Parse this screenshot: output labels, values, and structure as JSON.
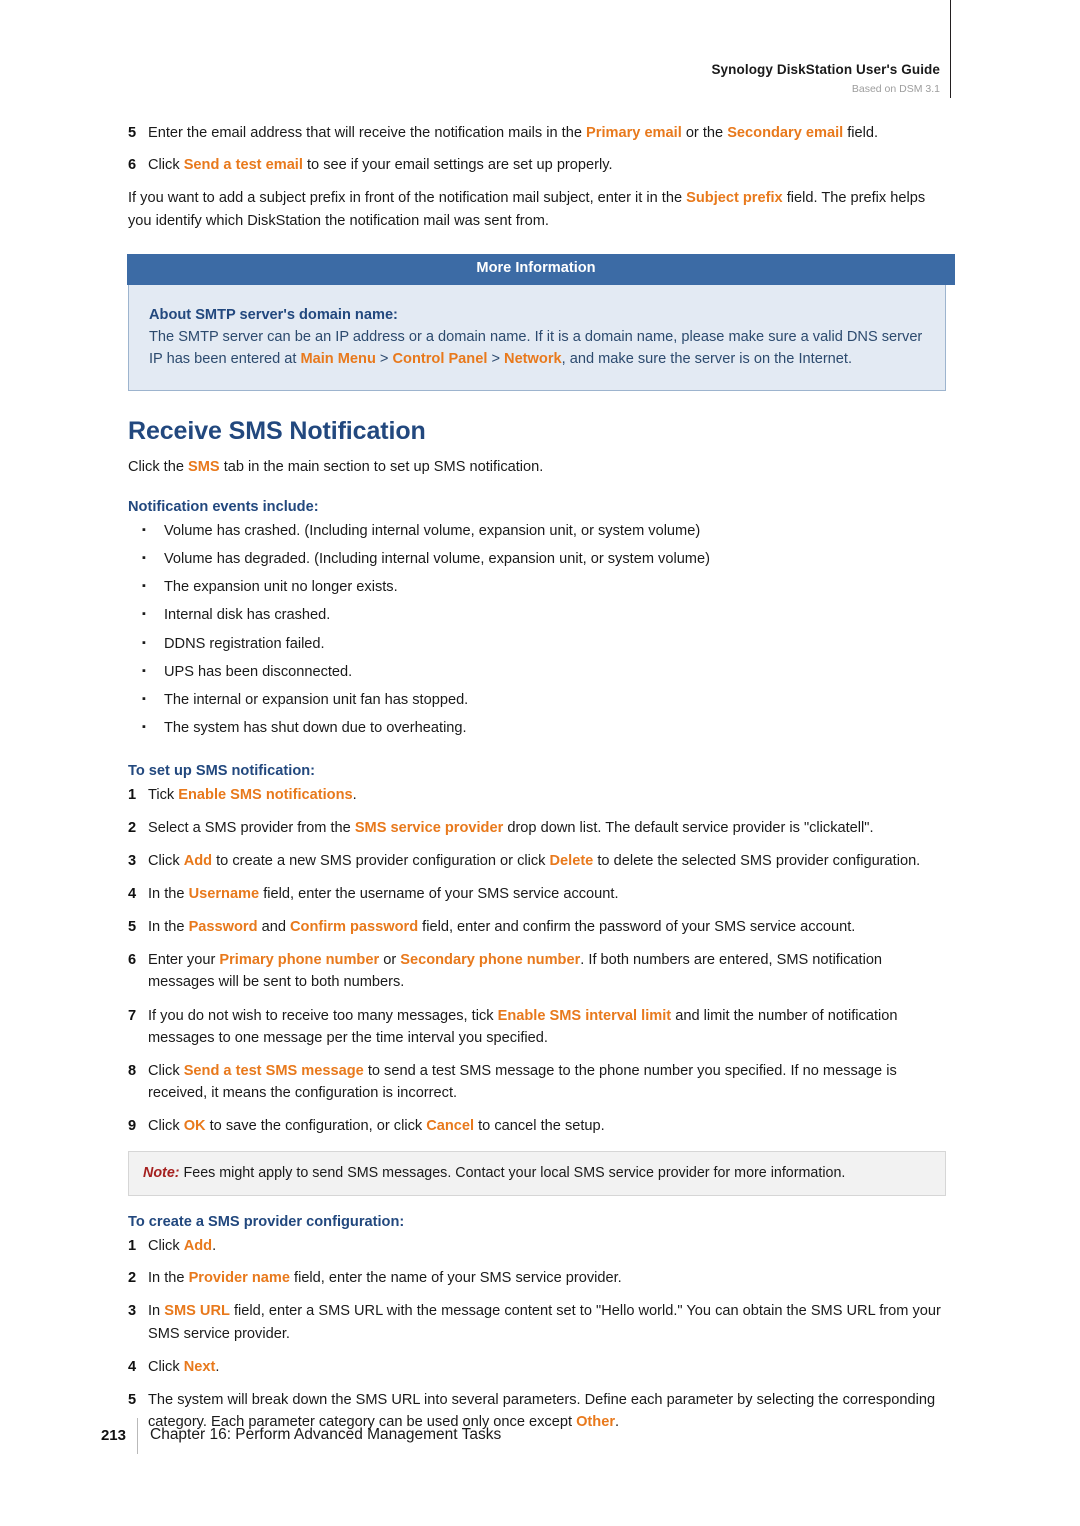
{
  "header": {
    "title": "Synology DiskStation User's Guide",
    "subtitle": "Based on DSM 3.1"
  },
  "intro_steps": [
    {
      "num": "5",
      "parts": [
        {
          "t": "Enter the email address that will receive the notification mails in the ",
          "ui": false
        },
        {
          "t": "Primary email",
          "ui": true
        },
        {
          "t": " or the ",
          "ui": false
        },
        {
          "t": "Secondary email",
          "ui": true
        },
        {
          "t": " field.",
          "ui": false
        }
      ]
    },
    {
      "num": "6",
      "parts": [
        {
          "t": "Click ",
          "ui": false
        },
        {
          "t": "Send a test email",
          "ui": true
        },
        {
          "t": " to see if your email settings are set up properly.",
          "ui": false
        }
      ]
    }
  ],
  "intro_paragraph": {
    "parts": [
      {
        "t": "If you want to add a subject prefix in front of the notification mail subject, enter it in the ",
        "ui": false
      },
      {
        "t": "Subject prefix",
        "ui": true
      },
      {
        "t": " field. The prefix helps you identify which DiskStation the notification mail was sent from.",
        "ui": false
      }
    ]
  },
  "callout": {
    "caption": "More Information",
    "lead": "About SMTP server's domain name:",
    "body_parts": [
      {
        "t": "The SMTP server can be an IP address or a domain name. If it is a domain name, please make sure a valid DNS server IP has been entered at ",
        "ui": false
      },
      {
        "t": "Main Menu",
        "ui": true
      },
      {
        "t": " > ",
        "ui": false
      },
      {
        "t": "Control Panel",
        "ui": true
      },
      {
        "t": " > ",
        "ui": false
      },
      {
        "t": "Network",
        "ui": true
      },
      {
        "t": ", and make sure the server is on the Internet.",
        "ui": false
      }
    ]
  },
  "section": {
    "title": "Receive SMS Notification",
    "intro_parts": [
      {
        "t": "Click the ",
        "ui": false
      },
      {
        "t": "SMS",
        "ui": true
      },
      {
        "t": " tab in the main section to set up SMS notification.",
        "ui": false
      }
    ]
  },
  "events": {
    "heading": "Notification events include:",
    "bullet_glyph": "▪",
    "items": [
      "Volume has crashed. (Including internal volume, expansion unit, or system volume)",
      "Volume has degraded. (Including internal volume, expansion unit, or system volume)",
      "The expansion unit no longer exists.",
      "Internal disk has crashed.",
      "DDNS registration failed.",
      "UPS has been disconnected.",
      "The internal or expansion unit fan has stopped.",
      "The system has shut down due to overheating."
    ]
  },
  "setup": {
    "heading": "To set up SMS notification:",
    "steps": [
      {
        "num": "1",
        "parts": [
          {
            "t": "Tick ",
            "ui": false
          },
          {
            "t": "Enable SMS notifications",
            "ui": true
          },
          {
            "t": ".",
            "ui": false
          }
        ]
      },
      {
        "num": "2",
        "parts": [
          {
            "t": "Select a SMS provider from the ",
            "ui": false
          },
          {
            "t": "SMS service provider",
            "ui": true
          },
          {
            "t": " drop down list. The default service provider is \"clickatell\".",
            "ui": false
          }
        ]
      },
      {
        "num": "3",
        "parts": [
          {
            "t": "Click ",
            "ui": false
          },
          {
            "t": "Add",
            "ui": true
          },
          {
            "t": " to create a new SMS provider configuration or click ",
            "ui": false
          },
          {
            "t": "Delete",
            "ui": true
          },
          {
            "t": " to delete the selected SMS provider configuration.",
            "ui": false
          }
        ]
      },
      {
        "num": "4",
        "parts": [
          {
            "t": "In the ",
            "ui": false
          },
          {
            "t": "Username",
            "ui": true
          },
          {
            "t": " field, enter the username of your SMS service account.",
            "ui": false
          }
        ]
      },
      {
        "num": "5",
        "parts": [
          {
            "t": "In the ",
            "ui": false
          },
          {
            "t": "Password",
            "ui": true
          },
          {
            "t": " and ",
            "ui": false
          },
          {
            "t": "Confirm password",
            "ui": true
          },
          {
            "t": " field, enter and confirm the password of your SMS service account.",
            "ui": false
          }
        ]
      },
      {
        "num": "6",
        "parts": [
          {
            "t": "Enter your ",
            "ui": false
          },
          {
            "t": "Primary phone number",
            "ui": true
          },
          {
            "t": " or ",
            "ui": false
          },
          {
            "t": "Secondary phone number",
            "ui": true
          },
          {
            "t": ". If both numbers are entered, SMS notification messages will be sent to both numbers.",
            "ui": false
          }
        ]
      },
      {
        "num": "7",
        "parts": [
          {
            "t": "If you do not wish to receive too many messages, tick ",
            "ui": false
          },
          {
            "t": "Enable SMS interval limit",
            "ui": true
          },
          {
            "t": " and limit the number of notification messages to one message per the time interval you specified.",
            "ui": false
          }
        ]
      },
      {
        "num": "8",
        "parts": [
          {
            "t": "Click ",
            "ui": false
          },
          {
            "t": "Send a test SMS message",
            "ui": true
          },
          {
            "t": " to send a test SMS message to the phone number you specified. If no message is received, it means the configuration is incorrect.",
            "ui": false
          }
        ]
      },
      {
        "num": "9",
        "parts": [
          {
            "t": "Click ",
            "ui": false
          },
          {
            "t": "OK",
            "ui": true
          },
          {
            "t": " to save the configuration, or click ",
            "ui": false
          },
          {
            "t": "Cancel",
            "ui": true
          },
          {
            "t": " to cancel the setup.",
            "ui": false
          }
        ]
      }
    ]
  },
  "note": {
    "label": "Note:",
    "text": " Fees might apply to send SMS messages. Contact your local SMS service provider for more information."
  },
  "provider": {
    "heading": "To create a SMS provider configuration:",
    "steps": [
      {
        "num": "1",
        "parts": [
          {
            "t": "Click ",
            "ui": false
          },
          {
            "t": "Add",
            "ui": true
          },
          {
            "t": ".",
            "ui": false
          }
        ]
      },
      {
        "num": "2",
        "parts": [
          {
            "t": "In the ",
            "ui": false
          },
          {
            "t": "Provider name",
            "ui": true
          },
          {
            "t": " field, enter the name of your SMS service provider.",
            "ui": false
          }
        ]
      },
      {
        "num": "3",
        "parts": [
          {
            "t": "In ",
            "ui": false
          },
          {
            "t": "SMS URL",
            "ui": true
          },
          {
            "t": " field, enter a SMS URL with the message content set to \"Hello world.\" You can obtain the SMS URL from your SMS service provider.",
            "ui": false
          }
        ]
      },
      {
        "num": "4",
        "parts": [
          {
            "t": "Click ",
            "ui": false
          },
          {
            "t": "Next",
            "ui": true
          },
          {
            "t": ".",
            "ui": false
          }
        ]
      },
      {
        "num": "5",
        "parts": [
          {
            "t": "The system will break down the SMS URL into several parameters. Define each parameter by selecting the corresponding category. Each parameter category can be used only once except ",
            "ui": false
          },
          {
            "t": "Other",
            "ui": true
          },
          {
            "t": ".",
            "ui": false
          }
        ]
      }
    ]
  },
  "footer": {
    "page_number": "213",
    "chapter": "Chapter 16: Perform Advanced Management Tasks"
  },
  "colors": {
    "accent_orange": "#e8791c",
    "heading_blue": "#22487e",
    "callout_bar": "#3c6ba5",
    "callout_bg": "#e3eaf3",
    "note_red": "#a5201f"
  }
}
